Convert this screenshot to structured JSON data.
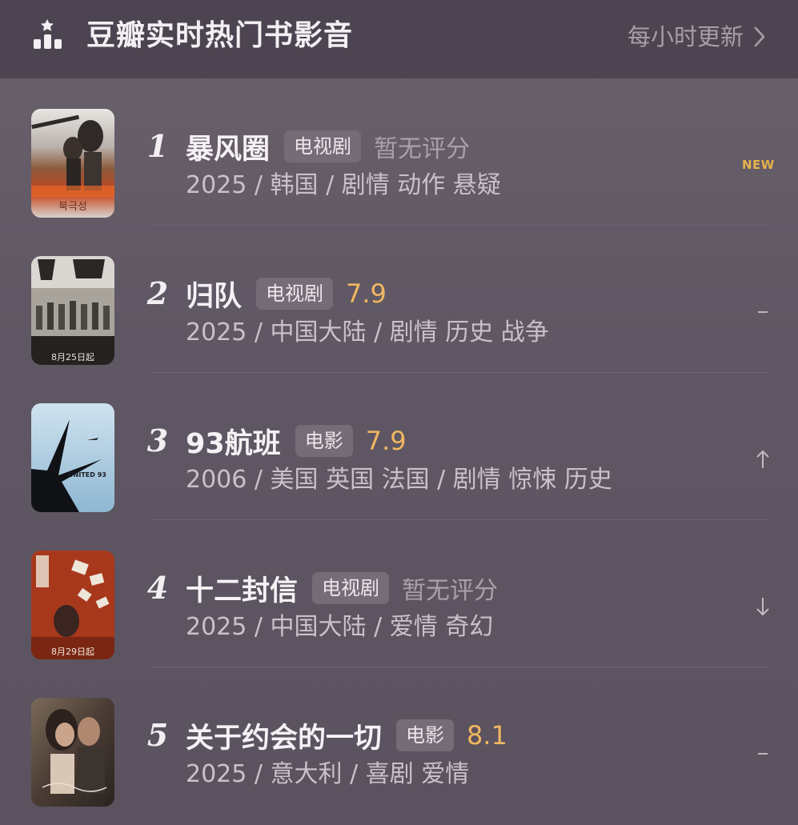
{
  "header": {
    "title": "豆瓣实时热门书影音",
    "update_link": "每小时更新",
    "icon": "ranking-bars-icon"
  },
  "items": [
    {
      "rank": "1",
      "title": "暴风圈",
      "type": "电视剧",
      "score": "暂无评分",
      "rated": false,
      "meta": "2025 / 韩国 / 剧情 动作 悬疑",
      "trend": "NEW",
      "poster_text": "북극성"
    },
    {
      "rank": "2",
      "title": "归队",
      "type": "电视剧",
      "score": "7.9",
      "rated": true,
      "meta": "2025 / 中国大陆 / 剧情 历史 战争",
      "trend": "–",
      "poster_text": "8月25日起"
    },
    {
      "rank": "3",
      "title": "93航班",
      "type": "电影",
      "score": "7.9",
      "rated": true,
      "meta": "2006 / 美国 英国 法国 / 剧情 惊悚 历史",
      "trend": "↑",
      "poster_text": "UNITED 93"
    },
    {
      "rank": "4",
      "title": "十二封信",
      "type": "电视剧",
      "score": "暂无评分",
      "rated": false,
      "meta": "2025 / 中国大陆 / 爱情 奇幻",
      "trend": "↓",
      "poster_text": "8月29日起"
    },
    {
      "rank": "5",
      "title": "关于约会的一切",
      "type": "电影",
      "score": "8.1",
      "rated": true,
      "meta": "2025 / 意大利 / 喜剧 爱情",
      "trend": "–",
      "poster_text": ""
    }
  ],
  "colors": {
    "header_bg": "#4c4450",
    "card_bg": "#5f5763",
    "score_rated": "#f0b661",
    "new_badge": "#e5b24c",
    "tag_bg": "#756c78"
  }
}
